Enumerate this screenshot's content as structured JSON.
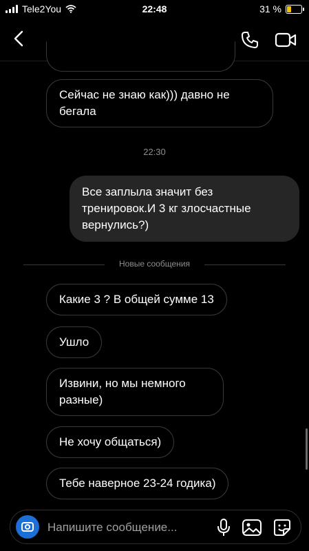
{
  "status_bar": {
    "carrier": "Tele2You",
    "time": "22:48",
    "battery": "31 %",
    "battery_level": 0.31
  },
  "messages": {
    "top_partial": "",
    "m1": "Сейчас не знаю как))) давно не бегала",
    "timestamp": "22:30",
    "m2": "Все заплыла значит без тренировок.И 3 кг злосчастные вернулись?)",
    "divider_label": "Новые сообщения",
    "m3": "Какие 3 ? В общей сумме 13",
    "m4": "Ушло",
    "m5": "Извини, но мы немного разные)",
    "m6": "Не хочу общаться)",
    "m7": "Тебе наверное 23-24 годика)"
  },
  "composer": {
    "placeholder": "Напишите сообщение..."
  },
  "colors": {
    "background": "#000000",
    "outgoing_bubble": "#262626",
    "incoming_border": "#3a3a3a",
    "camera_button": "#1c6fd6",
    "battery_fill": "#f2c200"
  },
  "icons": [
    "back-arrow-icon",
    "phone-icon",
    "video-camera-icon",
    "camera-icon",
    "microphone-icon",
    "gallery-icon",
    "sticker-icon"
  ]
}
